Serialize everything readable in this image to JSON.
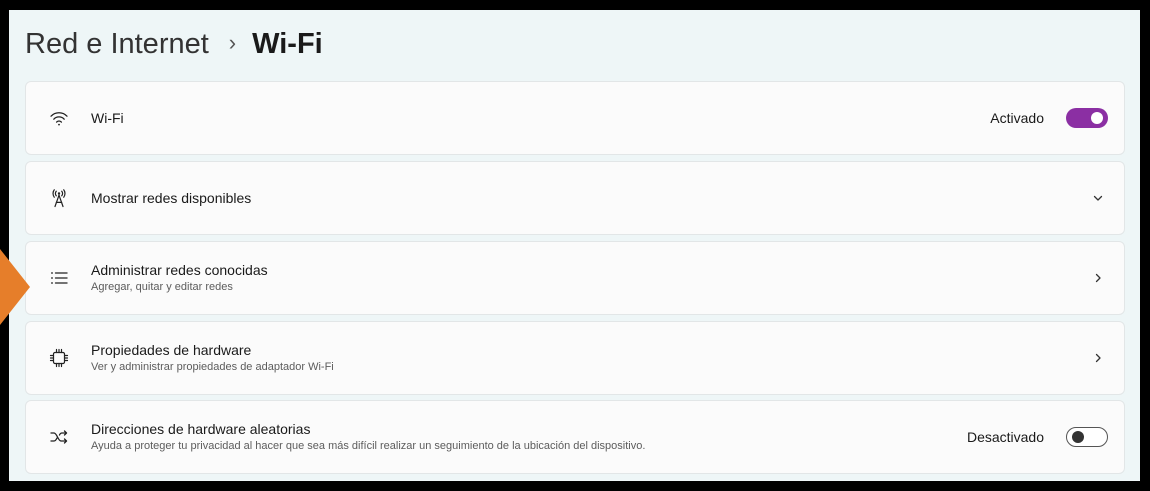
{
  "header": {
    "parent": "Red e Internet",
    "separator": "›",
    "current": "Wi-Fi"
  },
  "rows": [
    {
      "icon": "wifi-icon",
      "title": "Wi-Fi",
      "status": "Activado",
      "toggle": true
    },
    {
      "icon": "antenna-icon",
      "title": "Mostrar redes disponibles",
      "control": "chevron-down"
    },
    {
      "icon": "list-icon",
      "title": "Administrar redes conocidas",
      "subtitle": "Agregar, quitar y editar redes",
      "control": "chevron-right"
    },
    {
      "icon": "chip-icon",
      "title": "Propiedades de hardware",
      "subtitle": "Ver y administrar propiedades de adaptador Wi-Fi",
      "control": "chevron-right"
    },
    {
      "icon": "shuffle-icon",
      "title": "Direcciones de hardware aleatorias",
      "subtitle": "Ayuda a proteger tu privacidad al hacer que sea más difícil realizar un seguimiento de la ubicación del dispositivo.",
      "status": "Desactivado",
      "toggle": false
    }
  ],
  "colors": {
    "accent": "#8b2fa3",
    "pointer": "#e67e2a",
    "page_background": "#eef6f7"
  }
}
